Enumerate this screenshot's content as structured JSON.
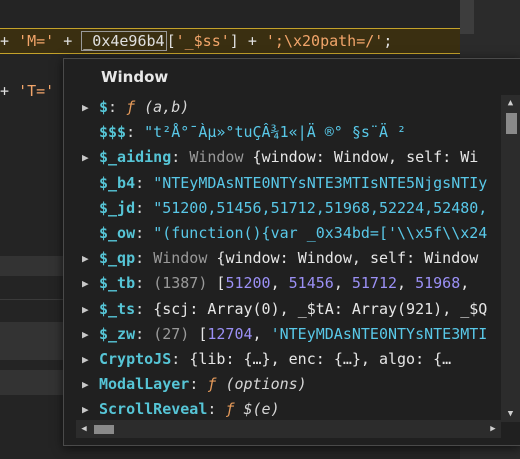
{
  "editor": {
    "line1": {
      "plus1": "+",
      "str1": "'M='",
      "plus2": "+",
      "ident": "_0x4e96b4",
      "bracket_open": "[",
      "str2": "'_$ss'",
      "bracket_close": "]",
      "plus3": "+",
      "str3": "';\\x20path=/'",
      "semi": ";"
    },
    "line2": {
      "plus": "+",
      "str": "'T='"
    }
  },
  "popover": {
    "title": "Window",
    "rows": [
      {
        "expandable": true,
        "key": "$",
        "colon": ":",
        "func_mark": "ƒ",
        "args": "(a,b)"
      },
      {
        "expandable": false,
        "key": "$$$",
        "colon": ":",
        "value": "\"t²Å°¯Àµ»°tuÇÂ¾1«|Ä   ®°   §s¨Ä  ²  "
      },
      {
        "expandable": true,
        "key": "$_aiding",
        "colon": ":",
        "type": "Window",
        "brace_open": "{",
        "p1k": "window",
        "p1v": "Window",
        "p2k": "self",
        "p2v": "Wi"
      },
      {
        "expandable": false,
        "key": "$_b4",
        "colon": ":",
        "value": "\"NTEyMDAsNTE0NTYsNTE3MTIsNTE5NjgsNTIy"
      },
      {
        "expandable": false,
        "key": "$_jd",
        "colon": ":",
        "value": "\"51200,51456,51712,51968,52224,52480,"
      },
      {
        "expandable": false,
        "key": "$_ow",
        "colon": ":",
        "value": "\"(function(){var _0x34bd=['\\\\x5f\\\\x24"
      },
      {
        "expandable": true,
        "key": "$_qp",
        "colon": ":",
        "type": "Window",
        "brace_open": "{",
        "p1k": "window",
        "p1v": "Window",
        "p2k": "self",
        "p2v": "Window"
      },
      {
        "expandable": true,
        "key": "$_tb",
        "colon": ":",
        "count": "(1387)",
        "bracket": "[",
        "n1": "51200",
        "n2": "51456",
        "n3": "51712",
        "n4": "51968"
      },
      {
        "expandable": true,
        "key": "$_ts",
        "colon": ":",
        "brace_open": "{",
        "p1k": "scj",
        "p1v": "Array(0)",
        "p2k": "_$tA",
        "p2v": "Array(921)",
        "p3k": "_$Q"
      },
      {
        "expandable": true,
        "key": "$_zw",
        "colon": ":",
        "count": "(27)",
        "bracket": "[",
        "n1": "12704",
        "s1": "'NTEyMDAsNTE0NTYsNTE3MTI"
      },
      {
        "expandable": true,
        "key": "CryptoJS",
        "colon": ":",
        "brace_open": "{",
        "p1k": "lib",
        "p1v": "{…}",
        "p2k": "enc",
        "p2v": "{…}",
        "p3k": "algo",
        "p3v": "{…"
      },
      {
        "expandable": true,
        "key": "ModalLayer",
        "colon": ":",
        "func_mark": "ƒ",
        "args": "(options)"
      },
      {
        "expandable": true,
        "key": "ScrollReveal",
        "colon": ":",
        "func_mark": "ƒ",
        "args": "$(e)"
      }
    ]
  },
  "colors": {
    "key": "#56c5d6",
    "string": "#59c8e8",
    "number": "#9b90f5",
    "function": "#e59a5a",
    "highlight_border": "#c4a22a"
  },
  "icons": {
    "expand": "triangle-right-icon",
    "scroll_up": "triangle-up-icon",
    "scroll_down": "triangle-down-icon",
    "scroll_left": "triangle-left-icon",
    "scroll_right": "triangle-right-icon"
  }
}
